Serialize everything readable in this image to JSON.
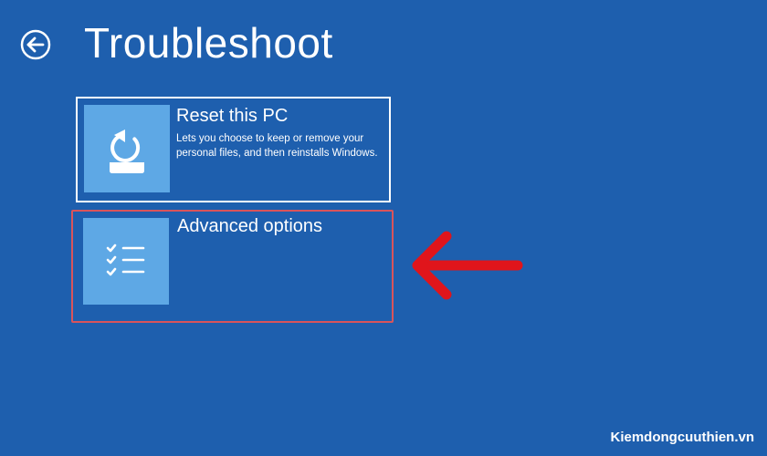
{
  "header": {
    "title": "Troubleshoot",
    "back_icon": "back-arrow-circle-icon"
  },
  "options": [
    {
      "title": "Reset this PC",
      "description": "Lets you choose to keep or remove your personal files, and then reinstalls Windows.",
      "icon": "reset-pc-icon",
      "highlighted": false
    },
    {
      "title": "Advanced options",
      "description": "",
      "icon": "checklist-icon",
      "highlighted": true
    }
  ],
  "annotation": {
    "arrow_icon": "red-arrow-left-icon",
    "arrow_color": "#e0151b",
    "highlight_color": "#d9545b"
  },
  "watermark": {
    "text": "Kiemdongcuuthien.vn"
  },
  "colors": {
    "background": "#1e5fae",
    "tile": "#5ea8e5",
    "text": "#ffffff"
  }
}
